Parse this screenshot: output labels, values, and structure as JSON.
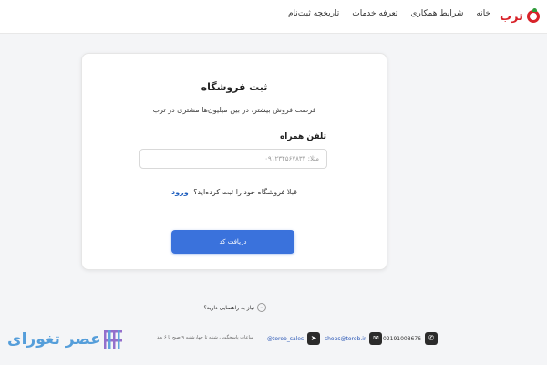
{
  "header": {
    "brand": "ترب",
    "nav": [
      "خانه",
      "شرایط همکاری",
      "تعرفه خدمات",
      "تاریخچه ثبت‌نام"
    ]
  },
  "card": {
    "title": "ثبت فروشگاه",
    "subtitle": "فرصت فروش بیشتر، در بین میلیون‌ها مشتری در ترب",
    "phone_label": "تلفن همراه",
    "phone_placeholder": "مثلا: ۰۹۱۲۳۴۵۶۷۸۳۴",
    "login_question": "قبلا فروشگاه خود را ثبت کرده‌اید؟",
    "login_link": "ورود",
    "submit_label": "دریافت کد"
  },
  "help": {
    "label": "نیاز به راهنمایی دارید؟"
  },
  "footer": {
    "phone": "02191008676",
    "email": "shops@torob.ir",
    "telegram": "@torob_sales",
    "hours": "ساعات پاسخگویی شنبه تا چهارشنبه ۹ صبح تا ۶ بعد"
  },
  "watermark": {
    "text": "عصر تغورای"
  },
  "colors": {
    "brand": "#d8232a",
    "primary": "#3a72dc",
    "link": "#1f5fbf"
  }
}
